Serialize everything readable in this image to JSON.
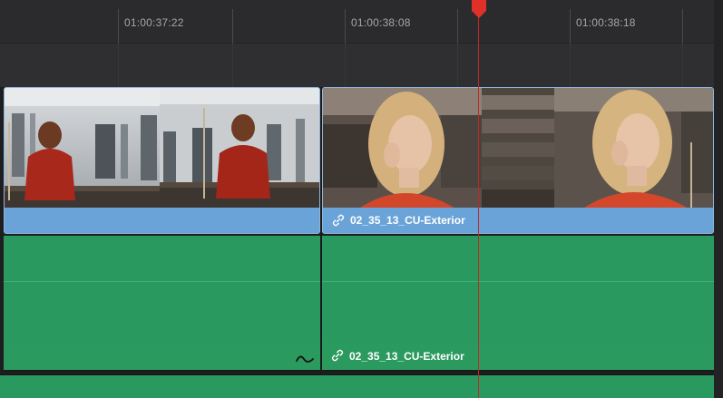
{
  "ruler": {
    "timecodes": [
      "01:00:37:22",
      "01:00:38:08",
      "01:00:38:18"
    ]
  },
  "video_track": {
    "clips": [
      {
        "name": ""
      },
      {
        "name": "02_35_13_CU-Exterior"
      }
    ]
  },
  "audio_track": {
    "clips": [
      {
        "name": ""
      },
      {
        "name": "02_35_13_CU-Exterior"
      }
    ]
  },
  "colors": {
    "video_clip": "#6aa3d8",
    "audio_clip": "#2a9960",
    "playhead": "#c02a24"
  },
  "icons": {
    "link": "link-icon",
    "playhead": "playhead-marker-icon",
    "fade": "audio-fade-curve-icon"
  }
}
